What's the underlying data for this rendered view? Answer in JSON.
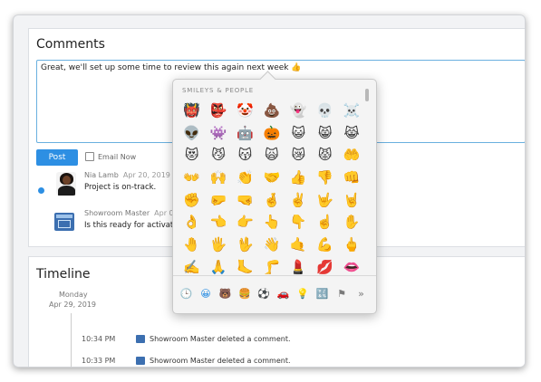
{
  "comments": {
    "title": "Comments",
    "input_value": "Great, we'll set up some time to review this again next week 👍",
    "post_label": "Post",
    "email_now_label": "Email Now"
  },
  "feed": [
    {
      "name": "Nia Lamb",
      "date": "Apr 20, 2019 1",
      "text": "Project is on-track."
    },
    {
      "name": "Showroom Master",
      "date": "Apr 0",
      "text": "Is this ready for activation"
    }
  ],
  "timeline": {
    "title": "Timeline",
    "day": "Monday",
    "date": "Apr 29, 2019",
    "entries": [
      {
        "time": "10:34 PM",
        "text": "Showroom Master deleted a comment."
      },
      {
        "time": "10:33 PM",
        "text": "Showroom Master deleted a comment."
      }
    ]
  },
  "emoji_picker": {
    "header": "SMILEYS & PEOPLE",
    "emojis": [
      "👹",
      "👺",
      "🤡",
      "💩",
      "👻",
      "💀",
      "☠️",
      "👽",
      "👾",
      "🤖",
      "🎃",
      "😺",
      "😸",
      "😹",
      "😻",
      "😼",
      "😽",
      "🙀",
      "😿",
      "😾",
      "🤲",
      "👐",
      "🙌",
      "👏",
      "🤝",
      "👍",
      "👎",
      "👊",
      "✊",
      "🤛",
      "🤜",
      "🤞",
      "✌️",
      "🤟",
      "🤘",
      "👌",
      "👈",
      "👉",
      "👆",
      "👇",
      "☝️",
      "✋",
      "🤚",
      "🖐️",
      "🖖",
      "👋",
      "🤙",
      "💪",
      "🖕",
      "✍️",
      "🙏",
      "🦶",
      "🦵",
      "💄",
      "💋",
      "👄"
    ],
    "categories": [
      "🕒",
      "😀",
      "🐻",
      "🍔",
      "⚽",
      "🚗",
      "💡",
      "🔣",
      "⚑",
      "»"
    ],
    "active_category_index": 1
  },
  "colors": {
    "accent": "#2d8fe3",
    "border": "#6ab0df"
  }
}
